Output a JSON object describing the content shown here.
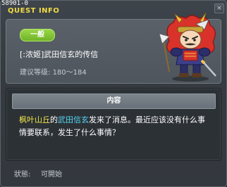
{
  "window": {
    "id_text": "58901-0",
    "title": "QUEST INFO",
    "close_glyph": "×"
  },
  "quest": {
    "category": "一般",
    "name": "[:浓姬]武田信玄的传信",
    "level_label": "建议等级:",
    "level_range": "180～184",
    "npc_icon": "samurai-warrior-icon"
  },
  "content": {
    "header": "内容",
    "segments": [
      {
        "text": "枫叶山丘",
        "style": "yellow"
      },
      {
        "text": "的",
        "style": "normal"
      },
      {
        "text": "武田信玄",
        "style": "cyan"
      },
      {
        "text": "发来了消息。最近应该没有什么事情要联系，发生了什么事情？",
        "style": "normal"
      }
    ]
  },
  "status": {
    "label": "狀態:",
    "value": "可開始"
  },
  "colors": {
    "title": "#f0dc46",
    "badge_green": "#8cc63f",
    "highlight_place": "#f0e348",
    "highlight_npc": "#56d4f0"
  }
}
